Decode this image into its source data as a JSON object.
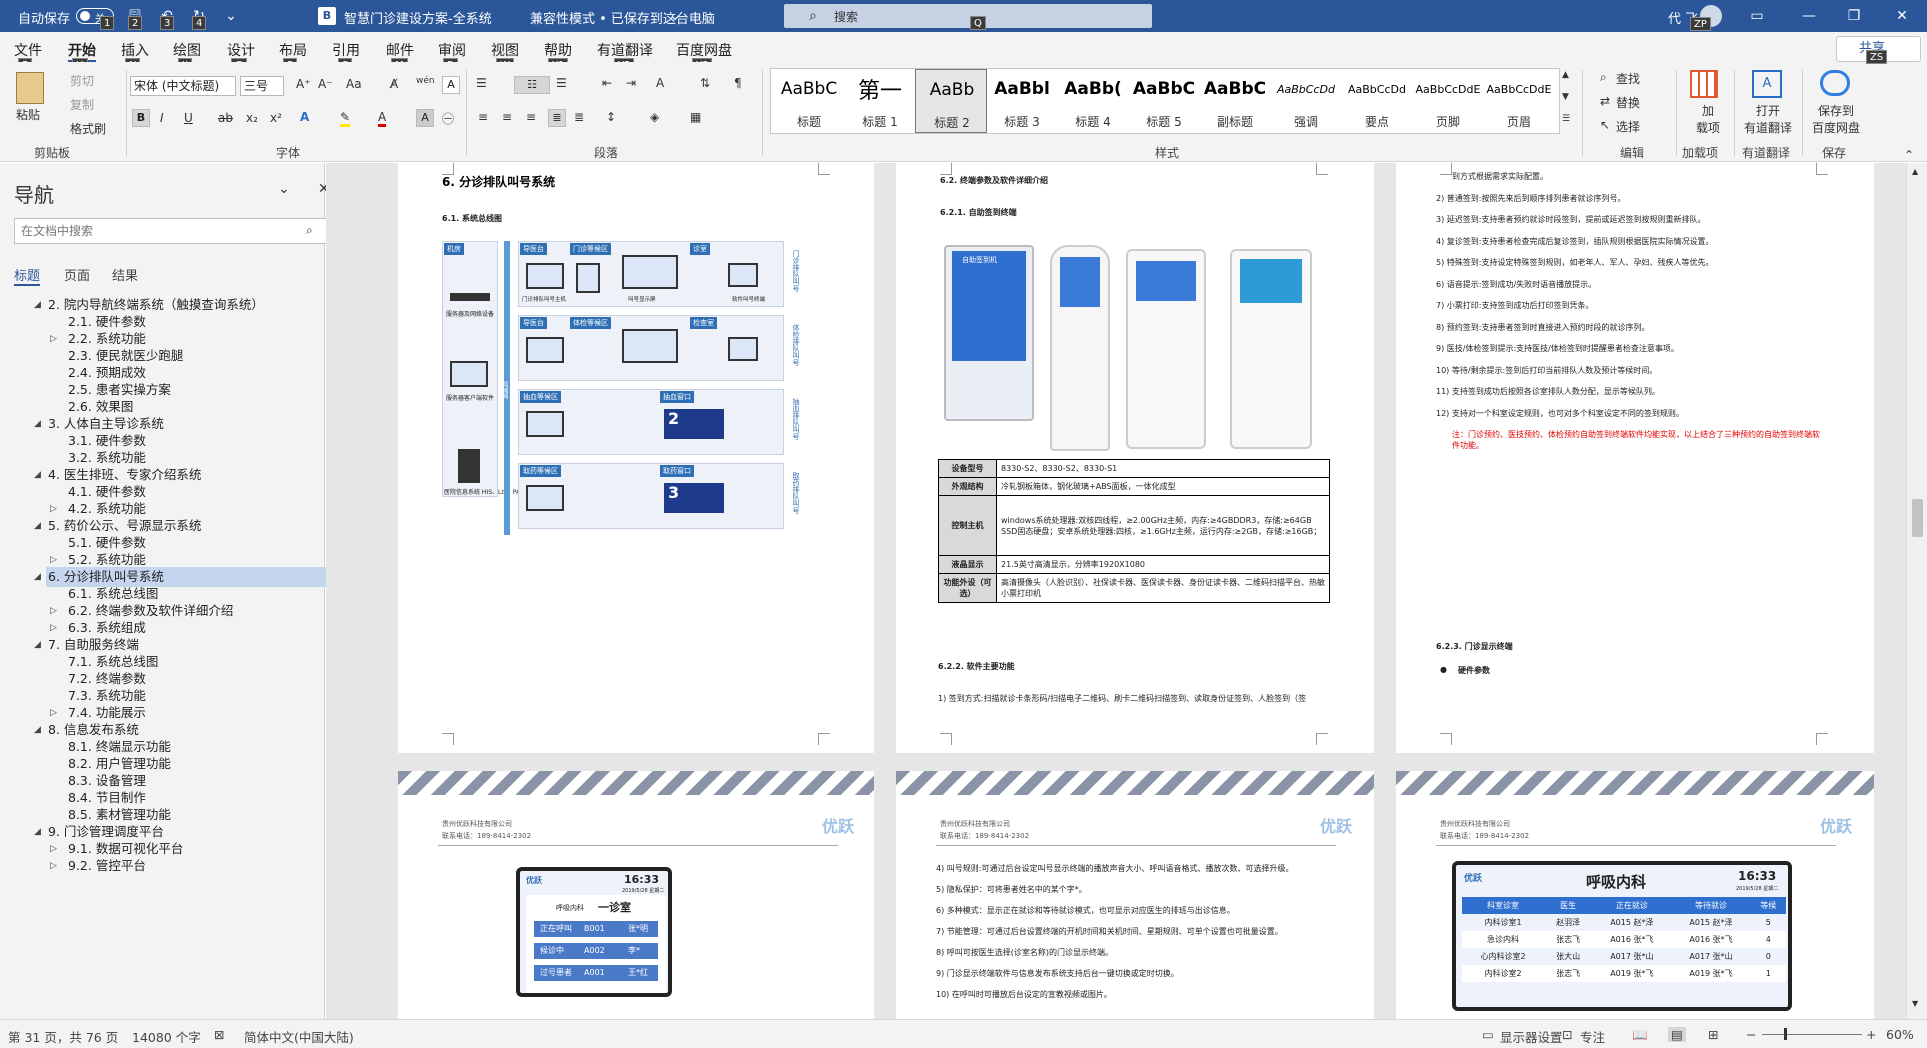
{
  "titlebar": {
    "autosave_label": "自动保存",
    "autosave_state": "关",
    "doc_title": "智慧门诊建设方案-全系统",
    "mode": "兼容性模式 • 已保存到这台电脑",
    "search_placeholder": "搜索",
    "user_name": "代 飞",
    "user_initials": "ZP",
    "keytips": [
      "1",
      "2",
      "3",
      "4",
      "Q"
    ]
  },
  "tabs": [
    {
      "label": "文件",
      "key": "F"
    },
    {
      "label": "开始",
      "key": "H"
    },
    {
      "label": "插入",
      "key": "N"
    },
    {
      "label": "绘图",
      "key": "JI"
    },
    {
      "label": "设计",
      "key": "G"
    },
    {
      "label": "布局",
      "key": "P"
    },
    {
      "label": "引用",
      "key": "S"
    },
    {
      "label": "邮件",
      "key": "M"
    },
    {
      "label": "审阅",
      "key": "R"
    },
    {
      "label": "视图",
      "key": "W"
    },
    {
      "label": "帮助",
      "key": "Y1"
    },
    {
      "label": "有道翻译",
      "key": "Y2"
    },
    {
      "label": "百度网盘",
      "key": "Y3"
    }
  ],
  "share_label": "共享",
  "share_key": "ZS",
  "ribbon": {
    "clipboard": {
      "paste": "粘贴",
      "cut": "剪切",
      "copy": "复制",
      "format_painter": "格式刷",
      "label": "剪贴板"
    },
    "font": {
      "name": "宋体 (中文标题)",
      "size": "三号",
      "label": "字体"
    },
    "paragraph": {
      "label": "段落"
    },
    "styles": {
      "label": "样式",
      "items": [
        {
          "sample": "AaBbC",
          "name": "标题"
        },
        {
          "sample": "第一",
          "name": "标题 1"
        },
        {
          "sample": "AaBb",
          "name": "标题 2"
        },
        {
          "sample": "AaBbl",
          "name": "标题 3"
        },
        {
          "sample": "AaBb(",
          "name": "标题 4"
        },
        {
          "sample": "AaBbC",
          "name": "标题 5"
        },
        {
          "sample": "AaBbC",
          "name": "副标题"
        },
        {
          "sample": "AaBbCcDd",
          "name": "强调"
        },
        {
          "sample": "AaBbCcDd",
          "name": "要点"
        },
        {
          "sample": "AaBbCcDdE",
          "name": "页脚"
        },
        {
          "sample": "AaBbCcDdE",
          "name": "页眉"
        }
      ],
      "selected": 2
    },
    "editing": {
      "find": "查找",
      "replace": "替换",
      "select": "选择",
      "label": "编辑"
    },
    "addins": {
      "btn": "加\n载项",
      "label": "加载项"
    },
    "youdao": {
      "btn": "打开\n有道翻译",
      "label": "有道翻译"
    },
    "save": {
      "btn": "保存到\n百度网盘",
      "label": "保存"
    }
  },
  "nav": {
    "title": "导航",
    "search_placeholder": "在文档中搜索",
    "tabs": [
      "标题",
      "页面",
      "结果"
    ],
    "items": [
      {
        "label": "2. 院内导航终端系统（触摸查询系统）",
        "level": 1,
        "exp": "open"
      },
      {
        "label": "2.1. 硬件参数",
        "level": 2,
        "exp": ""
      },
      {
        "label": "2.2. 系统功能",
        "level": 2,
        "exp": "closed"
      },
      {
        "label": "2.3. 便民就医少跑腿",
        "level": 2,
        "exp": ""
      },
      {
        "label": "2.4. 预期成效",
        "level": 2,
        "exp": ""
      },
      {
        "label": "2.5. 患者实操方案",
        "level": 2,
        "exp": ""
      },
      {
        "label": "2.6. 效果图",
        "level": 2,
        "exp": ""
      },
      {
        "label": "3. 人体自主导诊系统",
        "level": 1,
        "exp": "open"
      },
      {
        "label": "3.1. 硬件参数",
        "level": 2,
        "exp": ""
      },
      {
        "label": "3.2. 系统功能",
        "level": 2,
        "exp": ""
      },
      {
        "label": "4. 医生排班、专家介绍系统",
        "level": 1,
        "exp": "open"
      },
      {
        "label": "4.1. 硬件参数",
        "level": 2,
        "exp": ""
      },
      {
        "label": "4.2. 系统功能",
        "level": 2,
        "exp": "closed"
      },
      {
        "label": "5. 药价公示、号源显示系统",
        "level": 1,
        "exp": "open"
      },
      {
        "label": "5.1. 硬件参数",
        "level": 2,
        "exp": ""
      },
      {
        "label": "5.2. 系统功能",
        "level": 2,
        "exp": "closed"
      },
      {
        "label": "6. 分诊排队叫号系统",
        "level": 1,
        "exp": "open",
        "selected": true
      },
      {
        "label": "6.1. 系统总线图",
        "level": 2,
        "exp": ""
      },
      {
        "label": "6.2. 终端参数及软件详细介绍",
        "level": 2,
        "exp": "closed"
      },
      {
        "label": "6.3. 系统组成",
        "level": 2,
        "exp": "closed"
      },
      {
        "label": "7. 自助服务终端",
        "level": 1,
        "exp": "open"
      },
      {
        "label": "7.1. 系统总线图",
        "level": 2,
        "exp": ""
      },
      {
        "label": "7.2. 终端参数",
        "level": 2,
        "exp": ""
      },
      {
        "label": "7.3. 系统功能",
        "level": 2,
        "exp": ""
      },
      {
        "label": "7.4. 功能展示",
        "level": 2,
        "exp": "closed"
      },
      {
        "label": "8. 信息发布系统",
        "level": 1,
        "exp": "open"
      },
      {
        "label": "8.1. 终端显示功能",
        "level": 2,
        "exp": ""
      },
      {
        "label": "8.2. 用户管理功能",
        "level": 2,
        "exp": ""
      },
      {
        "label": "8.3. 设备管理",
        "level": 2,
        "exp": ""
      },
      {
        "label": "8.4. 节目制作",
        "level": 2,
        "exp": ""
      },
      {
        "label": "8.5. 素材管理功能",
        "level": 2,
        "exp": ""
      },
      {
        "label": "9. 门诊管理调度平台",
        "level": 1,
        "exp": "open"
      },
      {
        "label": "9.1. 数据可视化平台",
        "level": 2,
        "exp": "closed"
      },
      {
        "label": "9.2. 管控平台",
        "level": 2,
        "exp": "closed"
      }
    ]
  },
  "page1": {
    "heading": "6.  分诊排队叫号系统",
    "sub": "6.1.   系统总线图",
    "zones": [
      "机房",
      "导医台",
      "门诊等候区",
      "诊室",
      "导医台",
      "体检等候区",
      "检查室",
      "抽血等候区",
      "抽血窗口",
      "取药等候区",
      "取药窗口"
    ],
    "side_labels": [
      "门诊排队叫号",
      "体检排队叫号",
      "抽血排队叫号",
      "取药排队叫号"
    ],
    "devices": [
      "服务器及网络设备",
      "服务器客户端软件",
      "医院信息系统 HIS、LIS、PACS",
      "局域网"
    ],
    "unit_labels": [
      "门诊排队叫号主机",
      "取号机",
      "叫号显示屏",
      "医生呼叫",
      "诊室门口屏",
      "软件叫号终端"
    ]
  },
  "page2": {
    "sec": "6.2.   终端参数及软件详细介绍",
    "subsec": "6.2.1.   自助签到终端",
    "kiosk_screen_title": "自助签到机",
    "table": [
      {
        "k": "设备型号",
        "v": "8330-S2、8330-S2、8330-S1"
      },
      {
        "k": "外观结构",
        "v": "冷轧钢板箱体，钢化玻璃+ABS面板，一体化成型"
      },
      {
        "k": "控制主机",
        "v": "windows系统处理器:双核四线程，≥2.00GHz主频，内存:≥4GBDDR3，存储:≥64GB SSD固态硬盘；安卓系统处理器:四核，≥1.6GHz主频，运行内存:≥2GB，存储:≥16GB；"
      },
      {
        "k": "液晶显示",
        "v": "21.5英寸高清显示，分辨率1920X1080"
      },
      {
        "k": "功能外设（可选）",
        "v": "高清摄像头（人脸识别）、社保读卡器、医保读卡器、身份证读卡器、二维码扫描平台、热敏小票打印机"
      }
    ],
    "subsec2": "6.2.2.   软件主要功能",
    "item1": "1)   签到方式:扫描就诊卡条形码/扫描电子二维码、刷卡二维码扫描签到、读取身份证签到、人脸签到（签"
  },
  "page3": {
    "lines": [
      "到方式根据需求实际配置。",
      "2)   普通签到:按照先来后到顺序排列患者就诊序列号。",
      "3)   延迟签到:支持患者预约就诊时段签到，提前或延迟签到按规则重新排队。",
      "4)   复诊签到:支持患者检查完成后复诊签到，插队规则根据医院实际情况设置。",
      "5)   特殊签到:支持设定特殊签到规则，如老年人、军人、孕妇、残疾人等优先。",
      "6)   语音提示:签到成功/失败时语音播放提示。",
      "7)   小票打印:支持签到成功后打印签到凭条。",
      "8)   预约签到:支持患者签到时直接进入预约时段的就诊序列。",
      "9)   医技/体检签到提示:支持医技/体检签到时提醒患者检查注意事项。",
      "10)  等待/剩余提示:签到后打印当前排队人数及预计等候时间。",
      "11)  支持签到成功后按照各诊室排队人数分配，显示等候队列。",
      "12)  支持对一个科室设定规则，也可对多个科室设定不同的签到规则。"
    ],
    "note": "注：门诊预约、医技预约、体检预约自助签到终端软件均能实现，以上结合了三种预约的自助签到终端软件功能。",
    "sub": "6.2.3.   门诊显示终端",
    "bullet": "硬件参数"
  },
  "bottom": {
    "company": "贵州优跃科技有限公司",
    "phone": "联系电话：189-8414-2302",
    "logo": "优跃",
    "sign1": {
      "clock": "16:33",
      "date": "2019/5/28 星期二",
      "dept": "呼吸内科",
      "room": "一诊室",
      "rows": [
        [
          "正在呼叫",
          "B001",
          "张*明"
        ],
        [
          "候诊中",
          "A002",
          "李*"
        ],
        [
          "过号患者",
          "A001",
          "王*红"
        ]
      ]
    },
    "lines_mid": [
      "4)   叫号规则:可通过后台设定叫号显示终端的播放声音大小、呼叫语音格式、播放次数、可选择升级。",
      "5)   隐私保护：可将患者姓名中的某个字*。",
      "6)   多种模式：显示正在就诊和等待就诊模式，也可显示对应医生的排班与出诊信息。",
      "7)   节能管理：可通过后台设置终端的开机时间和关机时间、星期规则、可单个设置也可批量设置。",
      "8)   呼叫可按医生选择(诊室名称)的门诊显示终端。",
      "9)   门诊显示终端软件与信息发布系统支持后台一键切换或定时切换。",
      "10)  在呼叫时可播放后台设定的宣教视频或图片。"
    ],
    "sign2": {
      "clock": "16:33",
      "date": "2019/5/28 星期二",
      "title": "呼吸内科",
      "headers": [
        "科室诊室",
        "医生",
        "正在就诊",
        "等待就诊",
        "等候"
      ],
      "rows": [
        [
          "内科诊室1",
          "赵羽泽",
          "A015 赵*泽",
          "A015 赵*泽",
          "5"
        ],
        [
          "急诊内科",
          "张志飞",
          "A016 张*飞",
          "A016 张*飞",
          "4"
        ],
        [
          "心内科诊室2",
          "张大山",
          "A017 张*山",
          "A017 张*山",
          "0"
        ],
        [
          "内科诊室2",
          "张志飞",
          "A019 张*飞",
          "A019 张*飞",
          "1"
        ]
      ]
    }
  },
  "status": {
    "page": "第 31 页，共 76 页",
    "words": "14080 个字",
    "lang": "简体中文(中国大陆)",
    "display": "显示器设置",
    "focus": "专注",
    "zoom": "60%"
  }
}
